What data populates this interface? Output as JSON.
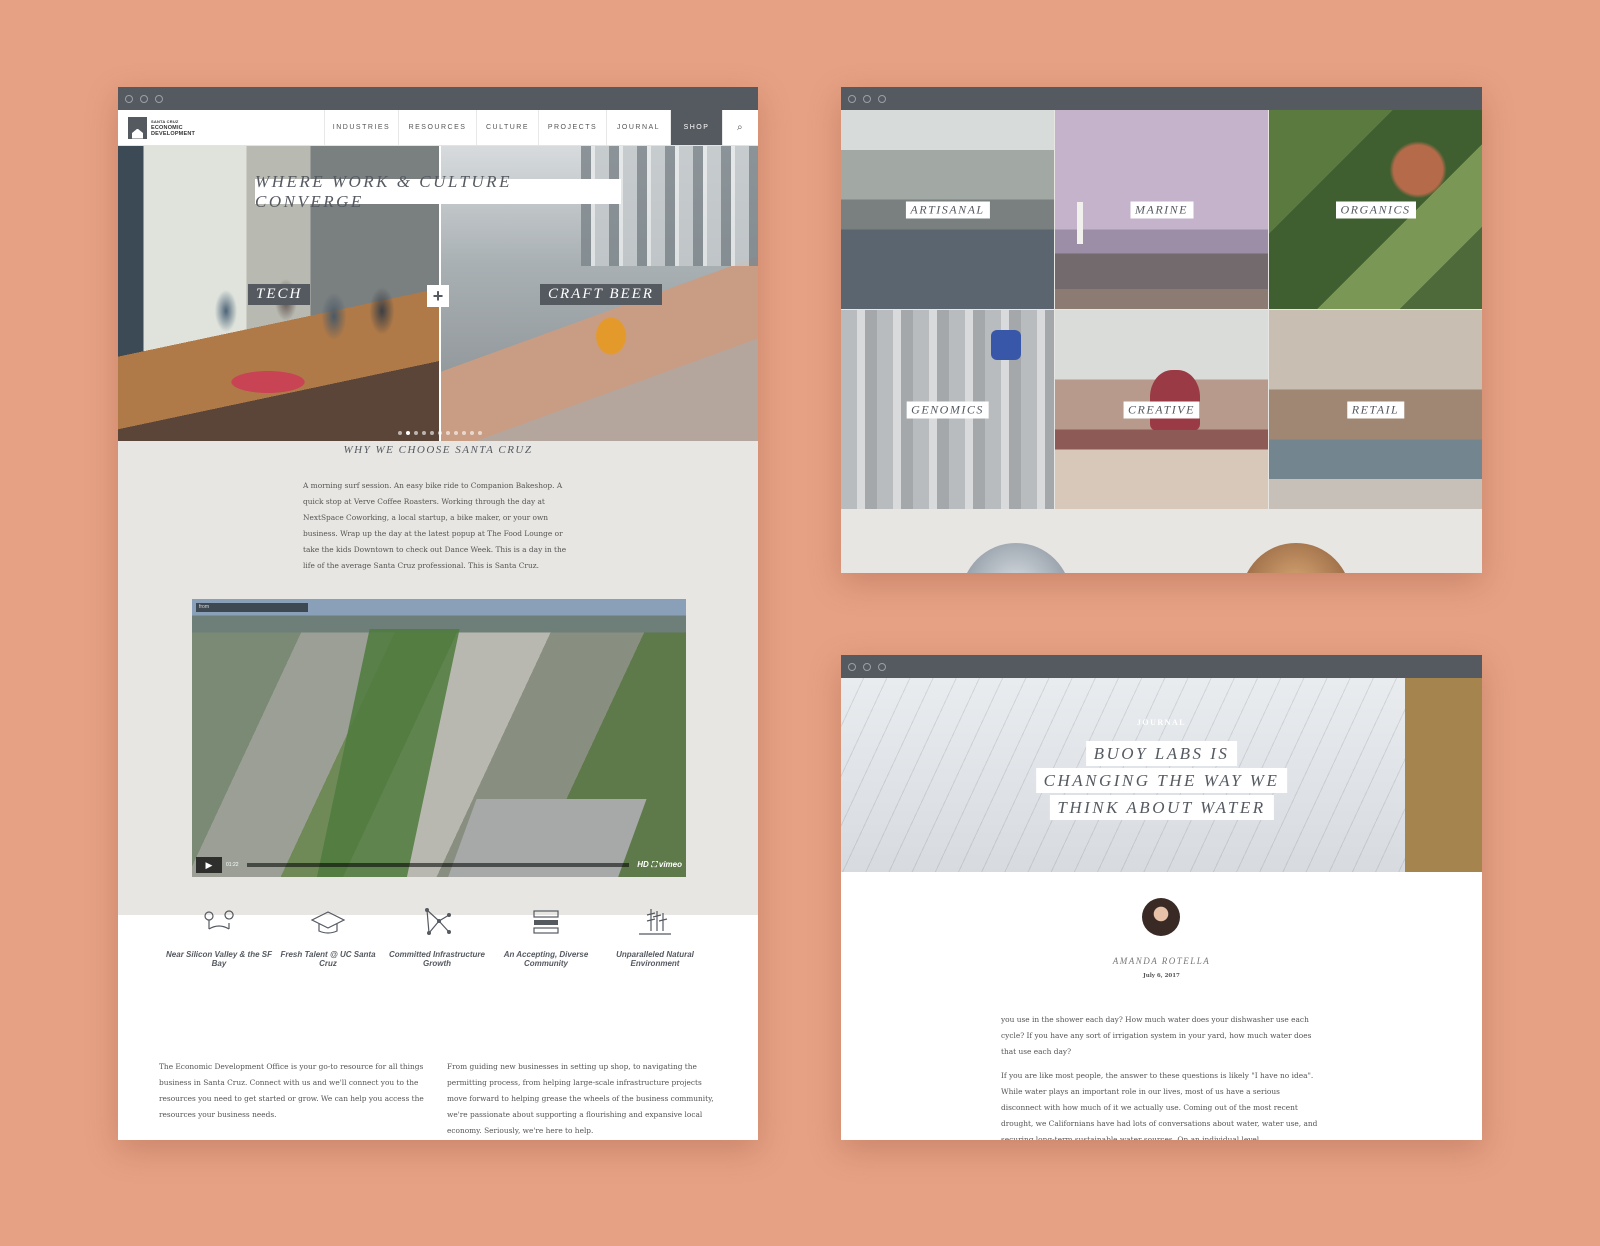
{
  "window_main": {
    "logo": {
      "line1": "SANTA CRUZ",
      "line2": "ECONOMIC",
      "line3": "DEVELOPMENT"
    },
    "nav": [
      "INDUSTRIES",
      "RESOURCES",
      "CULTURE",
      "PROJECTS",
      "JOURNAL",
      "SHOP"
    ],
    "search_icon": "⌕",
    "hero": {
      "title": "WHERE WORK & CULTURE CONVERGE",
      "left_label": "TECH",
      "right_label": "CRAFT BEER",
      "plus": "+"
    },
    "why": {
      "title": "WHY WE CHOOSE SANTA CRUZ",
      "body": "A morning surf session. An easy bike ride to Companion Bakeshop. A quick stop at Verve Coffee Roasters. Working through the day at NextSpace Coworking, a local startup, a bike maker, or your own business. Wrap up the day at the latest popup at The Food Lounge or take the kids Downtown to check out Dance Week. This is a day in the life of the average Santa Cruz professional. This is Santa Cruz."
    },
    "video": {
      "from": "from",
      "time": "01:22",
      "brand": "HD ⛶ vimeo",
      "play": "▶"
    },
    "features": [
      {
        "icon": "map-pin-icon",
        "label": "Near Silicon Valley & the SF Bay"
      },
      {
        "icon": "graduation-cap-icon",
        "label": "Fresh Talent @ UC Santa Cruz"
      },
      {
        "icon": "network-icon",
        "label": "Committed Infrastructure Growth"
      },
      {
        "icon": "community-icon",
        "label": "An Accepting, Diverse Community"
      },
      {
        "icon": "trees-icon",
        "label": "Unparalleled Natural Environment"
      }
    ],
    "about_left": "The Economic Development Office is your go-to resource for all things business in Santa Cruz. Connect with us and we'll connect you to the resources you need to get started or grow. We can help you access the resources your business needs.",
    "about_right": "From guiding new businesses in setting up shop, to navigating the permitting process, from helping large-scale infrastructure projects move forward to helping grease the wheels of the business community, we're passionate about supporting a flourishing and expansive local economy. Seriously, we're here to help."
  },
  "window_industries": {
    "cells": [
      "ARTISANAL",
      "MARINE",
      "ORGANICS",
      "GENOMICS",
      "CREATIVE",
      "RETAIL"
    ]
  },
  "window_journal": {
    "kicker": "JOURNAL",
    "title_lines": [
      "BUOY LABS IS",
      "CHANGING THE WAY WE",
      "THINK ABOUT WATER"
    ],
    "author": "AMANDA ROTELLA",
    "date": "July 6, 2017",
    "para1": "you use in the shower each day? How much water does your dishwasher use each cycle? If you have any sort of irrigation system in your yard, how much water does that use each day?",
    "para2": "If you are like most people, the answer to these questions is likely \"I have no idea\". While water plays an important role in our lives, most of us have a serious disconnect with how much of it we actually use. Coming out of the most recent drought, we Californians have had lots of conversations about water, water use, and securing long-term sustainable water sources. On an individual level"
  }
}
